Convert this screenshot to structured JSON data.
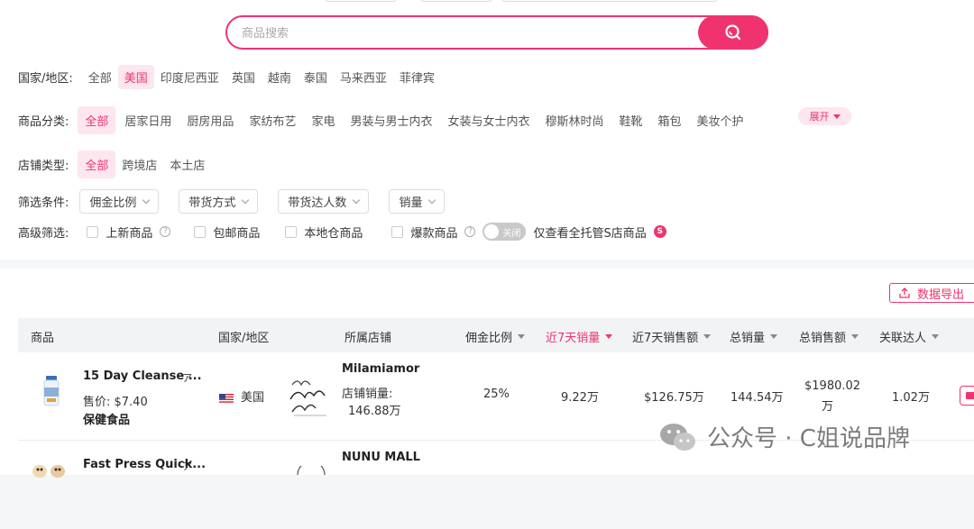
{
  "search": {
    "placeholder": "商品搜索"
  },
  "filters": {
    "country": {
      "label": "国家/地区:",
      "options": [
        "全部",
        "美国",
        "印度尼西亚",
        "英国",
        "越南",
        "泰国",
        "马来西亚",
        "菲律宾"
      ],
      "active": 1
    },
    "category": {
      "label": "商品分类:",
      "options": [
        "全部",
        "居家日用",
        "厨房用品",
        "家纺布艺",
        "家电",
        "男装与男士内衣",
        "女装与女士内衣",
        "穆斯林时尚",
        "鞋靴",
        "箱包",
        "美妆个护"
      ],
      "active": 0,
      "expand_label": "展开"
    },
    "store_type": {
      "label": "店铺类型:",
      "options": [
        "全部",
        "跨境店",
        "本土店"
      ],
      "active": 0
    },
    "conditions": {
      "label": "筛选条件:",
      "dropdowns": [
        "佣金比例",
        "带货方式",
        "带货达人数",
        "销量"
      ]
    },
    "advanced": {
      "label": "高级筛选:",
      "checkboxes": [
        "上新商品",
        "包邮商品",
        "本地仓商品",
        "爆款商品"
      ],
      "toggle_label": "关闭",
      "toggle_text": "仅查看全托管S店商品",
      "s_badge": "S"
    }
  },
  "table": {
    "export_label": "数据导出",
    "headers": [
      "商品",
      "国家/地区",
      "所属店铺",
      "佣金比例",
      "近7天销量",
      "近7天销售额",
      "总销量",
      "总销售额",
      "关联达人"
    ],
    "rows": [
      {
        "product_name": "15 Day Cleanse ...",
        "price": "售价: $7.40",
        "category": "保健食品",
        "country": "美国",
        "store_name": "Milamiamor",
        "store_sales_label": "店铺销量:",
        "store_sales": "146.88万",
        "commission": "25%",
        "sales_7d": "9.22万",
        "revenue_7d": "$126.75万",
        "total_sales": "144.54万",
        "total_revenue_1": "$1980.02",
        "total_revenue_2": "万",
        "creators": "1.02万"
      },
      {
        "product_name": "Fast Press Quick...",
        "store_name": "NUNU MALL"
      }
    ]
  },
  "watermark": "公众号 · C姐说品牌",
  "colors": {
    "accent": "#f0336e",
    "accent_light": "#fde6ee",
    "bg": "#f5f6f8"
  }
}
